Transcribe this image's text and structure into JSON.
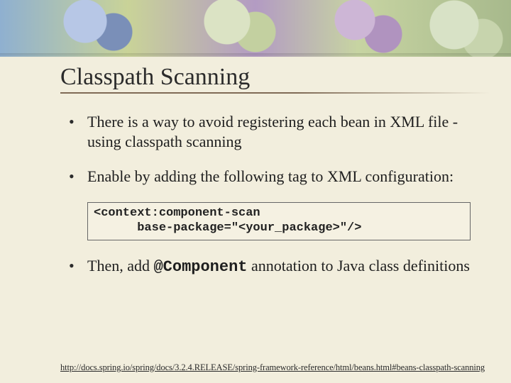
{
  "title": "Classpath Scanning",
  "bullets": {
    "b1": "There is a way to avoid registering each bean in XML file - using classpath scanning",
    "b2": "Enable by adding the following tag to XML configuration:",
    "b3_pre": "Then, add ",
    "b3_code": "@Component",
    "b3_post": " annotation to Java class definitions"
  },
  "codebox": "<context:component-scan\n      base-package=\"<your_package>\"/>",
  "footer": "http://docs.spring.io/spring/docs/3.2.4.RELEASE/spring-framework-reference/html/beans.html#beans-classpath-scanning"
}
